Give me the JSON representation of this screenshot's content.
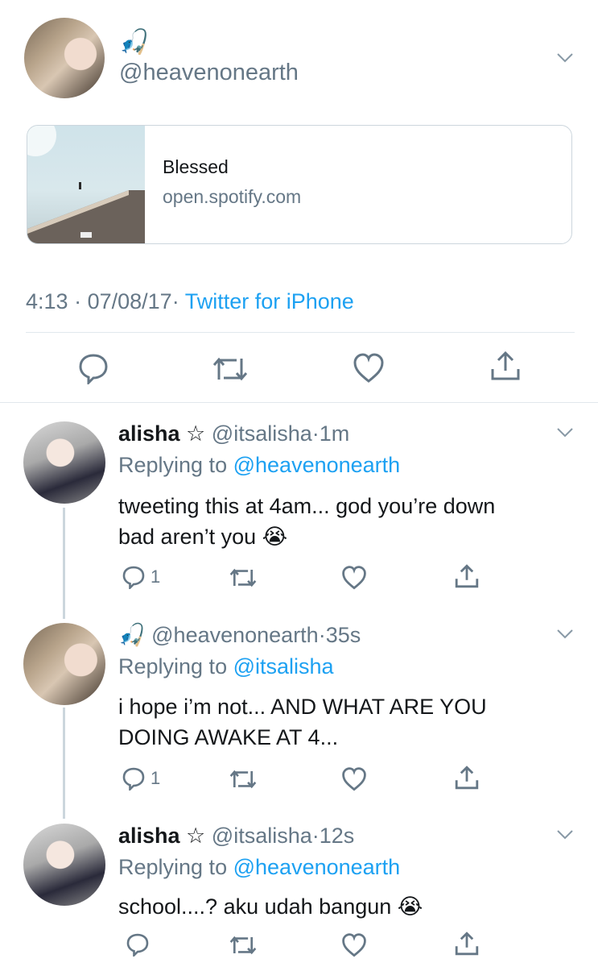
{
  "main_tweet": {
    "emoji": "🎣",
    "handle": "@heavenonearth",
    "card": {
      "title": "Blessed",
      "domain": "open.spotify.com"
    },
    "time": "4:13",
    "date_sep": "·",
    "date": "07/08/17",
    "source_sep": "·",
    "source": "Twitter for iPhone"
  },
  "replies": [
    {
      "name": "alisha ☆",
      "handle": "@itsalisha",
      "sep": "·",
      "time": "1m",
      "replying_prefix": "Replying to",
      "replying_to": "@heavenonearth",
      "text_line1": "tweeting this at 4am... god you’re down",
      "text_line2": "bad aren’t you",
      "emoji": "😭",
      "reply_count": "1"
    },
    {
      "emoji_name": "🎣",
      "handle": "@heavenonearth",
      "sep": "·",
      "time": "35s",
      "replying_prefix": "Replying to",
      "replying_to": "@itsalisha",
      "text_line1": "i hope i’m not... AND WHAT ARE YOU",
      "text_line2": "DOING AWAKE AT 4...",
      "reply_count": "1"
    },
    {
      "name": "alisha ☆",
      "handle": "@itsalisha",
      "sep": "·",
      "time": "12s",
      "replying_prefix": "Replying to",
      "replying_to": "@heavenonearth",
      "text_line1": "school....? aku udah bangun",
      "emoji": "😭"
    }
  ],
  "colors": {
    "link": "#1da1f2",
    "muted": "#657786",
    "border": "#e1e8ed"
  },
  "icons": [
    "reply-icon",
    "retweet-icon",
    "like-icon",
    "share-icon",
    "chevron-down-icon"
  ]
}
